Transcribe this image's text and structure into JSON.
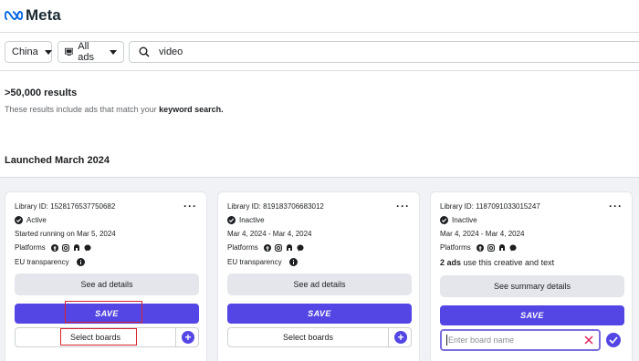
{
  "header": {
    "logo_text": "Meta"
  },
  "filters": {
    "country": "China",
    "ad_type": "All ads",
    "search_value": "video"
  },
  "results": {
    "count": ">50,000 results",
    "note_prefix": "These results include ads that match your ",
    "note_bold": "keyword search.",
    "launched": "Launched March 2024"
  },
  "cards": [
    {
      "library_id": "Library ID: 1528176537750682",
      "status": "Active",
      "dates": "Started running on Mar 5, 2024",
      "platforms_label": "Platforms",
      "eu_label": "EU transparency",
      "details_label": "See ad details",
      "save_label": "SAVE",
      "select_label": "Select boards"
    },
    {
      "library_id": "Library ID: 819183706683012",
      "status": "Inactive",
      "dates": "Mar 4, 2024 - Mar 4, 2024",
      "platforms_label": "Platforms",
      "eu_label": "EU transparency",
      "details_label": "See ad details",
      "save_label": "SAVE",
      "select_label": "Select boards"
    },
    {
      "library_id": "Library ID: 1187091033015247",
      "status": "Inactive",
      "dates": "Mar 4, 2024 - Mar 4, 2024",
      "platforms_label": "Platforms",
      "ads_count": "2 ads",
      "ads_text": " use this creative and text",
      "details_label": "See summary details",
      "save_label": "SAVE",
      "board_placeholder": "Enter board name"
    }
  ],
  "icons": {
    "logo": "meta-infinity-icon",
    "ad_type": "monitor-icon",
    "search": "search-icon",
    "status": "status-check-icon",
    "platforms": [
      "facebook-icon",
      "instagram-icon",
      "audience-network-icon",
      "messenger-icon"
    ],
    "info": "info-icon",
    "more": "more-options-icon",
    "add": "plus-icon",
    "clear": "close-icon",
    "confirm": "checkmark-icon"
  },
  "colors": {
    "accent": "#5346e4",
    "highlight": "#d9232d"
  }
}
